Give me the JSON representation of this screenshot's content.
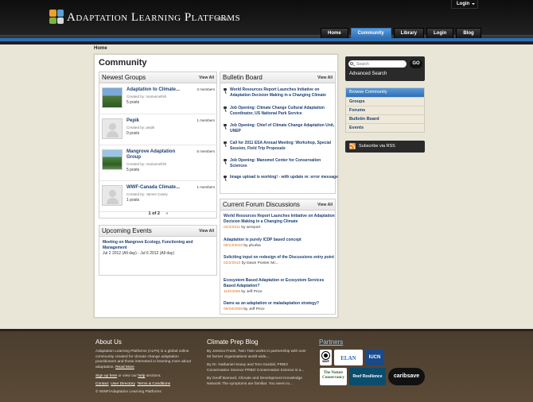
{
  "header": {
    "logo_title": "Adaptation Learning Platforms",
    "logo_beta": "BETA",
    "top_login": "Login",
    "nav": [
      "Home",
      "Community",
      "Library",
      "Login",
      "Blog"
    ],
    "active_nav": "Community"
  },
  "breadcrumb": "Home",
  "page_title": "Community",
  "newest_groups": {
    "title": "Newest Groups",
    "view_all": "View All",
    "items": [
      {
        "name": "Adaptation to Climate...",
        "created_by": "Created by: mariannefish",
        "posts": "5 posts",
        "members": "2 members"
      },
      {
        "name": "Pepik",
        "created_by": "Created by: pepik",
        "posts": "0 posts",
        "members": "1 members"
      },
      {
        "name": "Mangrove Adaptation Group",
        "created_by": "Created by: mariannefish",
        "posts": "5 posts",
        "members": "5 members"
      },
      {
        "name": "WWF-Canada Climate...",
        "created_by": "Created by: James Casey",
        "posts": "1 posts",
        "members": "1 members"
      }
    ],
    "pager": "1 of 2",
    "pager_next": "»"
  },
  "upcoming_events": {
    "title": "Upcoming Events",
    "view_all": "View All",
    "event_title": "Meeting on Mangrove Ecology, Functioning and Management",
    "event_date": "Jul 2 2012 (All day) - Jul 6 2012 (All day)"
  },
  "bulletin_board": {
    "title": "Bulletin Board",
    "view_all": "View All",
    "items": [
      "World Resources Report Launches Initiative on Adaptation Decision Making in a Changing Climate",
      "Job Opening: Climate Change Cultural Adaptation Coordinator, US National Park Service",
      "Job Opening: Chief of Climate Change Adaptation Unit, UNEP",
      "Call for 2011 ESA Annual Meeting: Workshop, Special Session, Field Trip Proposals",
      "Job Opening: Manomet Center for Conservation Sciences",
      "Image upload is working! - with update re: error message"
    ]
  },
  "forum": {
    "title": "Current Forum Discussions",
    "view_all": "View All",
    "items": [
      {
        "title": "World Resources Report Launches Initiative on Adaptation Decision Making in a Changing Climate",
        "date": "02/2/2011",
        "by": "by wrreport"
      },
      {
        "title": "Adaptation is purely ICDP based concept",
        "date": "05/13/2010",
        "by": "by phurba"
      },
      {
        "title": "Soliciting input on redesign of the Discussions entry point",
        "date": "02/2/2010",
        "by": "by Dawn Pointer Mc..."
      },
      {
        "title": "Ecosystem Based Adaptation or Ecosystem Services Based Adaptation?",
        "date": "11/6/2009",
        "by": "by Jeff Price"
      },
      {
        "title": "Dams as an adaptation or maladaptation strategy?",
        "date": "09/28/2009",
        "by": "by Jeff Price"
      }
    ]
  },
  "search": {
    "placeholder": "Search",
    "go": "GO",
    "advanced": "Advanced Search"
  },
  "browse": {
    "title": "Browse Community",
    "items": [
      "Groups",
      "Forums",
      "Bulletin Board",
      "Events"
    ]
  },
  "rss": "Subscribe via RSS",
  "footer": {
    "about_title": "About Us",
    "about_text": "Adaptation Learning Platforms (ALPs) is a global online community created for climate change adaptation practitioners and those interested in learning more about adaptation.",
    "read_more": "Read More",
    "signup_text": "Sign up here",
    "signup_rest": " or view our ",
    "help": "help",
    "signup_end": " sections.",
    "links": [
      "Contact",
      "User Directory",
      "Terms & Conditions"
    ],
    "copyright": "© WWF/Adaptation Learning Platforms",
    "blog_title": "Climate Prep Blog",
    "blog_items": [
      "By Jessica Frank, Twin Twin works in partnership with over 50 farmer organisations world wide,...",
      "By Dr. Nathaniel Seavy and Tom Gardali, PRBO Conservation Science PRBO Conservation Science is a...",
      "By Geoff Barnard, Climate and Development Knowledge Network The symptoms are familiar.  You seem to..."
    ],
    "partners_title": "Partners",
    "partners": [
      "WWF",
      "ELAN",
      "IUCN",
      "The Nature Conservancy",
      "Reef Resilience",
      "caribsave"
    ]
  },
  "colors": {
    "accent_blue": "#2e6fb5",
    "date_orange": "#e06c1a",
    "footer_brown": "#54442f"
  }
}
